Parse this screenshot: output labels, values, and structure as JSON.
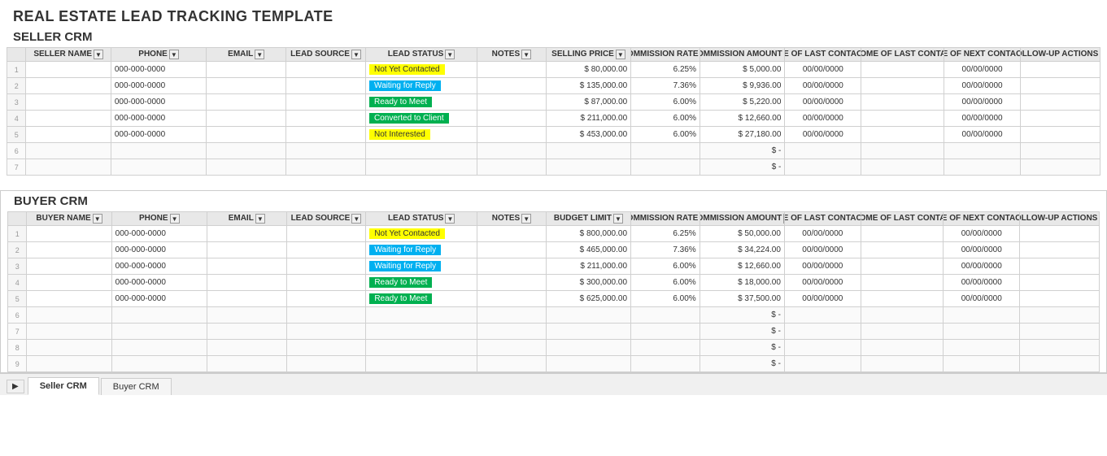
{
  "app": {
    "main_title": "REAL ESTATE LEAD TRACKING TEMPLATE",
    "seller_section_title": "SELLER CRM",
    "buyer_section_title": "BUYER CRM"
  },
  "seller_crm": {
    "headers": {
      "seller_name": "SELLER NAME",
      "phone": "PHONE",
      "email": "EMAIL",
      "lead_source": "LEAD SOURCE",
      "lead_status": "LEAD STATUS",
      "notes": "NOTES",
      "selling_price": "SELLING PRICE",
      "commission_rate": "COMMISSION RATE",
      "commission_amount": "COMMISSION AMOUNT",
      "date_last_contact": "DATE OF LAST CONTACT",
      "outcome_last_contact": "OUTCOME OF LAST CONTACT",
      "date_next_contact": "DATE OF NEXT CONTACT",
      "followup_actions": "FOLLOW-UP ACTIONS"
    },
    "rows": [
      {
        "phone": "000-000-0000",
        "status": "Not Yet Contacted",
        "status_class": "not-yet-contacted",
        "selling_price": "$ 80,000.00",
        "comm_rate": "6.25%",
        "comm_amount": "$ 5,000.00",
        "date_last": "00/00/0000",
        "date_next": "00/00/0000"
      },
      {
        "phone": "000-000-0000",
        "status": "Waiting for Reply",
        "status_class": "waiting-for-reply",
        "selling_price": "$ 135,000.00",
        "comm_rate": "7.36%",
        "comm_amount": "$ 9,936.00",
        "date_last": "00/00/0000",
        "date_next": "00/00/0000"
      },
      {
        "phone": "000-000-0000",
        "status": "Ready to Meet",
        "status_class": "ready-to-meet",
        "selling_price": "$ 87,000.00",
        "comm_rate": "6.00%",
        "comm_amount": "$ 5,220.00",
        "date_last": "00/00/0000",
        "date_next": "00/00/0000"
      },
      {
        "phone": "000-000-0000",
        "status": "Converted to Client",
        "status_class": "converted-to-client",
        "selling_price": "$ 211,000.00",
        "comm_rate": "6.00%",
        "comm_amount": "$ 12,660.00",
        "date_last": "00/00/0000",
        "date_next": "00/00/0000"
      },
      {
        "phone": "000-000-0000",
        "status": "Not Interested",
        "status_class": "not-interested",
        "selling_price": "$ 453,000.00",
        "comm_rate": "6.00%",
        "comm_amount": "$ 27,180.00",
        "date_last": "00/00/0000",
        "date_next": "00/00/0000"
      }
    ],
    "empty_rows": [
      {
        "comm_amount": "$ -"
      },
      {
        "comm_amount": "$ -"
      }
    ]
  },
  "buyer_crm": {
    "headers": {
      "buyer_name": "BUYER NAME",
      "phone": "PHONE",
      "email": "EMAIL",
      "lead_source": "LEAD SOURCE",
      "lead_status": "LEAD STATUS",
      "notes": "NOTES",
      "budget_limit": "BUDGET LIMIT",
      "commission_rate": "COMMISSION RATE",
      "commission_amount": "COMMISSION AMOUNT",
      "date_last_contact": "DATE OF LAST CONTACT",
      "outcome_last_contact": "OUTCOME OF LAST CONTACT",
      "date_next_contact": "DATE OF NEXT CONTACT",
      "followup_actions": "FOLLOW-UP ACTIONS"
    },
    "rows": [
      {
        "phone": "000-000-0000",
        "status": "Not Yet Contacted",
        "status_class": "not-yet-contacted",
        "budget": "$ 800,000.00",
        "comm_rate": "6.25%",
        "comm_amount": "$ 50,000.00",
        "date_last": "00/00/0000",
        "date_next": "00/00/0000"
      },
      {
        "phone": "000-000-0000",
        "status": "Waiting for Reply",
        "status_class": "waiting-for-reply",
        "budget": "$ 465,000.00",
        "comm_rate": "7.36%",
        "comm_amount": "$ 34,224.00",
        "date_last": "00/00/0000",
        "date_next": "00/00/0000"
      },
      {
        "phone": "000-000-0000",
        "status": "Waiting for Reply",
        "status_class": "waiting-for-reply",
        "budget": "$ 211,000.00",
        "comm_rate": "6.00%",
        "comm_amount": "$ 12,660.00",
        "date_last": "00/00/0000",
        "date_next": "00/00/0000"
      },
      {
        "phone": "000-000-0000",
        "status": "Ready to Meet",
        "status_class": "ready-to-meet",
        "budget": "$ 300,000.00",
        "comm_rate": "6.00%",
        "comm_amount": "$ 18,000.00",
        "date_last": "00/00/0000",
        "date_next": "00/00/0000"
      },
      {
        "phone": "000-000-0000",
        "status": "Ready to Meet",
        "status_class": "ready-to-meet",
        "budget": "$ 625,000.00",
        "comm_rate": "6.00%",
        "comm_amount": "$ 37,500.00",
        "date_last": "00/00/0000",
        "date_next": "00/00/0000"
      }
    ],
    "empty_rows": [
      {
        "comm_amount": "$ -"
      },
      {
        "comm_amount": "$ -"
      },
      {
        "comm_amount": "$ -"
      },
      {
        "comm_amount": "$ -"
      }
    ]
  },
  "tabs": {
    "seller_crm_label": "Seller CRM",
    "buyer_crm_label": "Buyer CRM"
  }
}
